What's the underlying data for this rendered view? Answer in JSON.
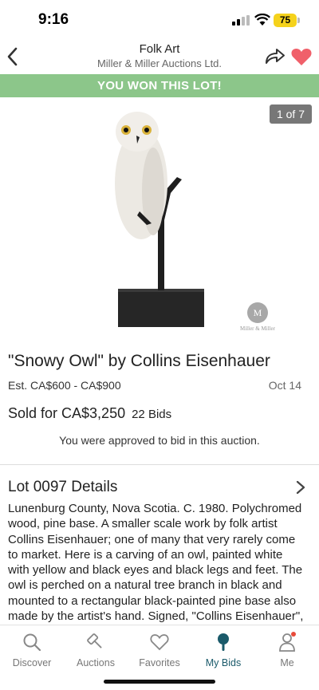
{
  "status_bar": {
    "time": "9:16",
    "battery": "75"
  },
  "header": {
    "title": "Folk Art",
    "subtitle": "Miller & Miller Auctions Ltd."
  },
  "banner": {
    "text": "YOU WON THIS LOT!",
    "color": "#8cc68a"
  },
  "image": {
    "counter": "1 of 7",
    "watermark_seal": "M",
    "watermark_text": "Miller & Miller"
  },
  "lot": {
    "title": "\"Snowy Owl\" by Collins Eisenhauer",
    "estimate": "Est. CA$600 - CA$900",
    "date": "Oct 14",
    "sold": "Sold for CA$3,250",
    "bids": "22 Bids",
    "approved": "You were approved to bid in this auction."
  },
  "details": {
    "title": "Lot 0097 Details",
    "text": "Lunenburg County, Nova Scotia. C. 1980. Polychromed wood, pine base. A smaller scale work by folk artist Collins Eisenhauer; one of many that very rarely come to market. Here is a carving of an owl, painted white with yellow and black eyes and black legs and feet. The owl is perched on a natural tree branch in black and mounted to a rectangular black-painted pine base also made by the artist's hand. Signed, \"Collins Eisenhauer\", on"
  },
  "tabs": [
    {
      "label": "Discover",
      "icon": "search-icon"
    },
    {
      "label": "Auctions",
      "icon": "gavel-icon"
    },
    {
      "label": "Favorites",
      "icon": "heart-icon"
    },
    {
      "label": "My Bids",
      "icon": "paddle-icon",
      "active": true
    },
    {
      "label": "Me",
      "icon": "person-icon"
    }
  ],
  "colors": {
    "accent": "#1a5a6a",
    "heart": "#f0606a",
    "notification": "#e84a3a",
    "battery": "#f5d21c"
  }
}
